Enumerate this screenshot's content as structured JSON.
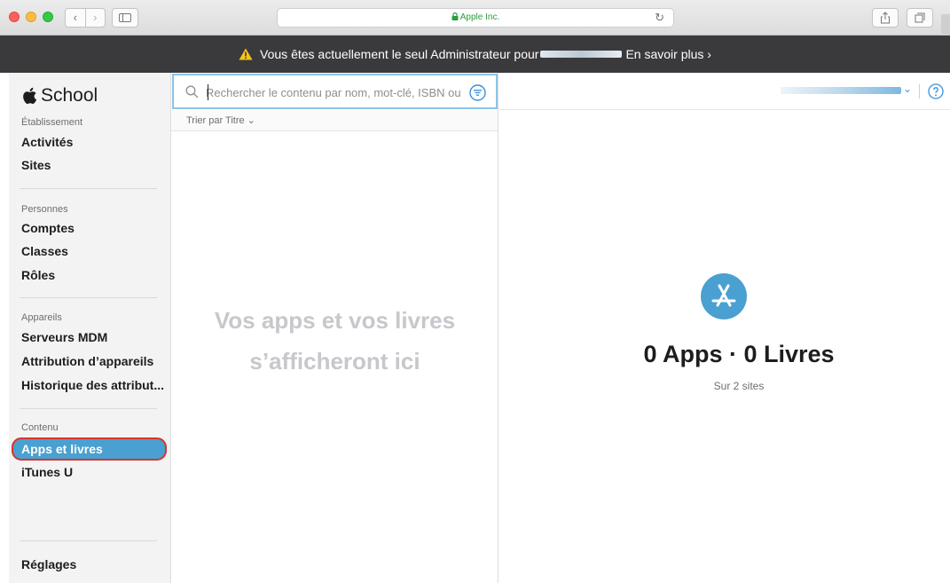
{
  "browser": {
    "url_text": "Apple Inc.",
    "icons": [
      "back-icon",
      "forward-icon",
      "sidebar-toggle-icon",
      "lock-icon",
      "reload-icon",
      "share-icon",
      "tabs-icon"
    ]
  },
  "banner": {
    "message": "Vous êtes actuellement le seul Administrateur pour",
    "link": "En savoir plus ›",
    "icon": "warning-icon"
  },
  "sidebar": {
    "brand": "School",
    "sections": [
      {
        "label": "Établissement",
        "items": [
          "Activités",
          "Sites"
        ]
      },
      {
        "label": "Personnes",
        "items": [
          "Comptes",
          "Classes",
          "Rôles"
        ]
      },
      {
        "label": "Appareils",
        "items": [
          "Serveurs MDM",
          "Attribution d’appareils",
          "Historique des attribut..."
        ]
      },
      {
        "label": "Contenu",
        "items": [
          "Apps et livres",
          "iTunes U"
        ]
      }
    ],
    "active_item": "Apps et livres",
    "settings": "Réglages"
  },
  "content_list": {
    "search_placeholder": "Rechercher le contenu par nom, mot-clé, ISBN ou",
    "sort_label": "Trier par Titre ⌄",
    "empty_message": "Vos apps et vos livres s’afficheront ici"
  },
  "summary": {
    "count_text": "0 Apps · 0 Livres",
    "sites_text": "Sur 2 sites"
  },
  "colors": {
    "accent": "#4aa0d0",
    "highlight_outline": "#d9352b",
    "banner_bg": "#3a3a3c",
    "warning": "#f5c518"
  }
}
